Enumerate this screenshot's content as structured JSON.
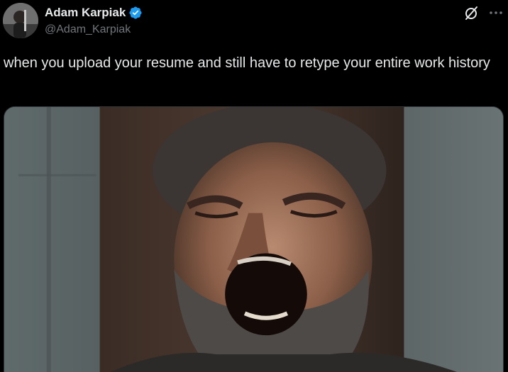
{
  "author": {
    "display_name": "Adam Karpiak",
    "handle": "@Adam_Karpiak",
    "verified": true
  },
  "tweet": {
    "text": "when you upload your resume and still have to retype your entire work history"
  },
  "icons": {
    "avatar": "avatar",
    "verified": "verified-badge-icon",
    "grok": "grok-icon",
    "more": "more-options-icon"
  },
  "colors": {
    "background": "#000000",
    "text_primary": "#e7e9ea",
    "text_secondary": "#71767b",
    "verified_blue": "#1d9bf0"
  }
}
